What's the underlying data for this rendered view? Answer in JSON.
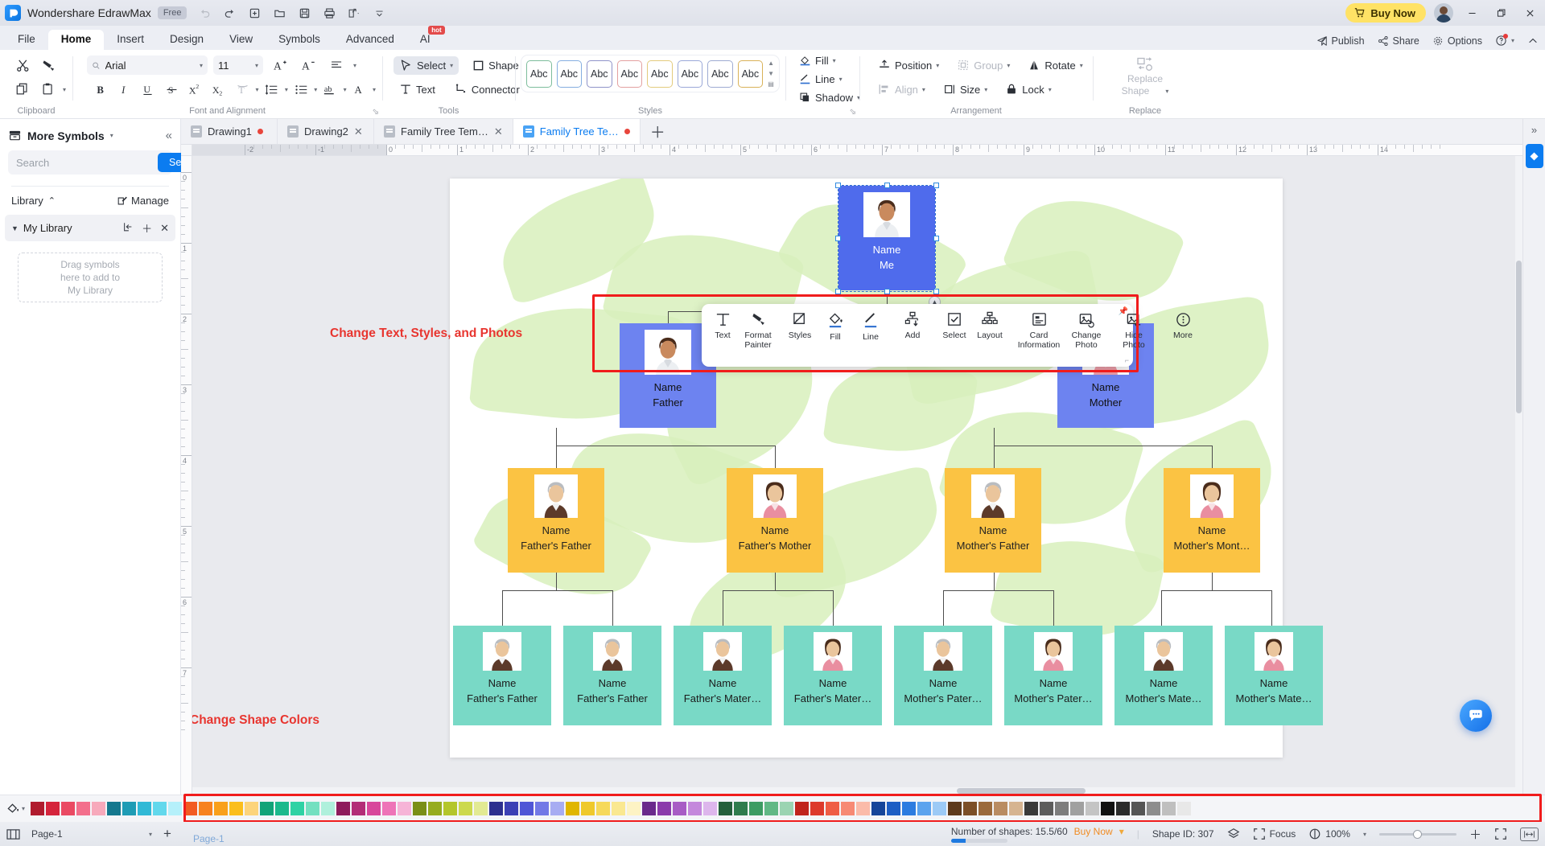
{
  "titlebar": {
    "app_name": "Wondershare EdrawMax",
    "plan_badge": "Free",
    "quick_access": [
      "undo-icon",
      "redo-icon",
      "new-icon",
      "open-icon",
      "save-icon",
      "print-icon",
      "export-icon",
      "more-qat-icon"
    ],
    "buy_now": "Buy Now",
    "window_buttons": [
      "minimize",
      "restore",
      "close"
    ]
  },
  "menubar": {
    "items": [
      {
        "label": "File",
        "active": false
      },
      {
        "label": "Home",
        "active": true
      },
      {
        "label": "Insert",
        "active": false
      },
      {
        "label": "Design",
        "active": false
      },
      {
        "label": "View",
        "active": false
      },
      {
        "label": "Symbols",
        "active": false
      },
      {
        "label": "Advanced",
        "active": false
      },
      {
        "label": "AI",
        "active": false,
        "badge": "hot"
      }
    ],
    "right": [
      {
        "label": "Publish",
        "icon": "publish-icon"
      },
      {
        "label": "Share",
        "icon": "share-icon"
      },
      {
        "label": "Options",
        "icon": "gear-icon"
      }
    ]
  },
  "ribbon": {
    "groups": [
      {
        "name": "Clipboard"
      },
      {
        "name": "Font and Alignment"
      },
      {
        "name": "Tools"
      },
      {
        "name": "Styles"
      },
      {
        "name": "Arrangement"
      },
      {
        "name": "Replace"
      }
    ],
    "clipboard": {
      "cut": "Cut",
      "format_painter": "Format Painter",
      "copy": "Copy",
      "paste": "Paste"
    },
    "font": {
      "family_value": "Arial",
      "family_placeholder": "Arial",
      "size_value": "11",
      "grow": "Increase Font Size",
      "shrink": "Decrease Font Size",
      "align": "Align",
      "bold": "B",
      "italic": "I",
      "underline": "U",
      "strike": "S",
      "superscript": "X²",
      "subscript": "X₂",
      "text_effects": "Text Effects",
      "line_spacing": "Line Spacing",
      "bullets": "Bullets",
      "text_case": "ab",
      "font_color": "A"
    },
    "tools": {
      "select": "Select",
      "shape": "Shape",
      "text": "Text",
      "connector": "Connector"
    },
    "styles": {
      "swatches": [
        "Abc",
        "Abc",
        "Abc",
        "Abc",
        "Abc",
        "Abc",
        "Abc",
        "Abc"
      ]
    },
    "format": {
      "fill": "Fill",
      "line": "Line",
      "shadow": "Shadow"
    },
    "arrangement": {
      "position": "Position",
      "group": "Group",
      "rotate": "Rotate",
      "align": "Align",
      "size": "Size",
      "lock": "Lock"
    },
    "replace": {
      "label_line1": "Replace",
      "label_line2": "Shape"
    }
  },
  "left_panel": {
    "title": "More Symbols",
    "search_placeholder": "Search",
    "search_button": "Search",
    "library_label": "Library",
    "manage_label": "Manage",
    "my_library_label": "My Library",
    "dropzone_lines": [
      "Drag symbols",
      "here to add to",
      "My Library"
    ]
  },
  "document_tabs": [
    {
      "label": "Drawing1",
      "active": false,
      "modified": true
    },
    {
      "label": "Drawing2",
      "active": false,
      "modified": false
    },
    {
      "label": "Family Tree Tem…",
      "active": false,
      "modified": false
    },
    {
      "label": "Family Tree Te…",
      "active": true,
      "modified": true
    }
  ],
  "ruler": {
    "h_labels": [
      "-2",
      "-1",
      "0",
      "1",
      "2",
      "3",
      "4",
      "5",
      "6",
      "7",
      "8",
      "9",
      "10",
      "11",
      "12",
      "13",
      "14"
    ],
    "v_labels": [
      "0",
      "1",
      "2",
      "3",
      "4",
      "5",
      "6",
      "7"
    ]
  },
  "floating_toolbar": {
    "items": [
      {
        "label": "Text",
        "icon": "text-icon"
      },
      {
        "label": "Format Painter",
        "icon": "format-painter-icon"
      },
      {
        "label": "Styles",
        "icon": "styles-icon"
      },
      {
        "label": "Fill",
        "icon": "fill-icon"
      },
      {
        "label": "Line",
        "icon": "line-icon"
      },
      {
        "label": "Add",
        "icon": "add-node-icon"
      },
      {
        "label": "Select",
        "icon": "select-check-icon"
      },
      {
        "label": "Layout",
        "icon": "layout-icon"
      },
      {
        "label": "Card Information",
        "icon": "card-information-icon"
      },
      {
        "label": "Change Photo",
        "icon": "change-photo-icon"
      },
      {
        "label": "Hide Photo",
        "icon": "hide-photo-icon"
      },
      {
        "label": "More",
        "icon": "more-icon"
      }
    ]
  },
  "annotations": [
    {
      "text": "Change Text, Styles, and Photos"
    },
    {
      "text": "Change Shape Colors"
    }
  ],
  "family_tree": {
    "name_label": "Name",
    "levels": [
      {
        "color": "#4f6bec",
        "text_color": "#ffffff",
        "nodes": [
          {
            "name": "Name",
            "relation": "Me",
            "avatar": "man-young"
          }
        ]
      },
      {
        "color": "#6d83f0",
        "text_color": "#111111",
        "nodes": [
          {
            "name": "Name",
            "relation": "Father",
            "avatar": "man-young"
          },
          {
            "name": "Name",
            "relation": "Mother",
            "avatar": "woman-young"
          }
        ]
      },
      {
        "color": "#fbc343",
        "text_color": "#222222",
        "nodes": [
          {
            "name": "Name",
            "relation": "Father's Father",
            "avatar": "man-old"
          },
          {
            "name": "Name",
            "relation": "Father's Mother",
            "avatar": "woman-mid"
          },
          {
            "name": "Name",
            "relation": "Mother's Father",
            "avatar": "man-old"
          },
          {
            "name": "Name",
            "relation": "Mother's Mont…",
            "avatar": "woman-mid"
          }
        ]
      },
      {
        "color": "#79d9c6",
        "text_color": "#1b1b1b",
        "nodes": [
          {
            "name": "Name",
            "relation": "Father's Father",
            "avatar": "man-old"
          },
          {
            "name": "Name",
            "relation": "Father's Father",
            "avatar": "man-old"
          },
          {
            "name": "Name",
            "relation": "Father's Mater…",
            "avatar": "man-old"
          },
          {
            "name": "Name",
            "relation": "Father's Mater…",
            "avatar": "woman-mid"
          },
          {
            "name": "Name",
            "relation": "Mother's Pater…",
            "avatar": "man-old"
          },
          {
            "name": "Name",
            "relation": "Mother's Pater…",
            "avatar": "woman-mid"
          },
          {
            "name": "Name",
            "relation": "Mother's Mate…",
            "avatar": "man-old"
          },
          {
            "name": "Name",
            "relation": "Mother's Mate…",
            "avatar": "woman-mid"
          }
        ]
      }
    ]
  },
  "palette": {
    "fill_label": "Fill Color",
    "colors": [
      "#b01b2e",
      "#d5243c",
      "#ea4a63",
      "#f36f8c",
      "#f7a9bb",
      "#15788e",
      "#1f9cb5",
      "#31b9d6",
      "#62d8ec",
      "#b5f0fa",
      "#f25b22",
      "#f7821f",
      "#f9a01b",
      "#fbbe1c",
      "#fcd47b",
      "#12a378",
      "#1bb98c",
      "#2fd2a4",
      "#74e0c0",
      "#aff0dc",
      "#8e1c5c",
      "#b32d77",
      "#d8479b",
      "#ee74b8",
      "#f6b4d7",
      "#7a8f17",
      "#96ac1f",
      "#b4c62b",
      "#ccd94e",
      "#e2ea93",
      "#2c2f8f",
      "#3b40b5",
      "#4f56d6",
      "#7279e6",
      "#a7acf2",
      "#e0b600",
      "#efc92c",
      "#f6d95b",
      "#fae890",
      "#fdf3c4",
      "#6a2a8c",
      "#8b3bab",
      "#a85cc5",
      "#c488dc",
      "#ddb6ec",
      "#245f3b",
      "#2f7c4d",
      "#3d9c63",
      "#61b885",
      "#9bd4b2",
      "#c0241c",
      "#dd3a2c",
      "#ef5d45",
      "#f78a74",
      "#fbbba9",
      "#15459a",
      "#1d5ec4",
      "#2c7ce0",
      "#5ba3ee",
      "#9ccaf6",
      "#5d3a1c",
      "#7c4f27",
      "#9b6a3c",
      "#b98c62",
      "#d6b491",
      "#3a3a3a",
      "#5c5c5c",
      "#7d7d7d",
      "#a0a0a0",
      "#c4c4c4",
      "#111111",
      "#2b2b2b",
      "#555555",
      "#8d8d8d",
      "#bfbfbf",
      "#e8e8e8"
    ]
  },
  "status_bar": {
    "page_name": "Page-1",
    "page_tab_label": "Page-1",
    "add_page": "+",
    "shape_count": "Number of shapes: 15.5/60",
    "buy_now": "Buy Now",
    "shape_id": "Shape ID: 307",
    "focus": "Focus",
    "zoom": "100%"
  }
}
